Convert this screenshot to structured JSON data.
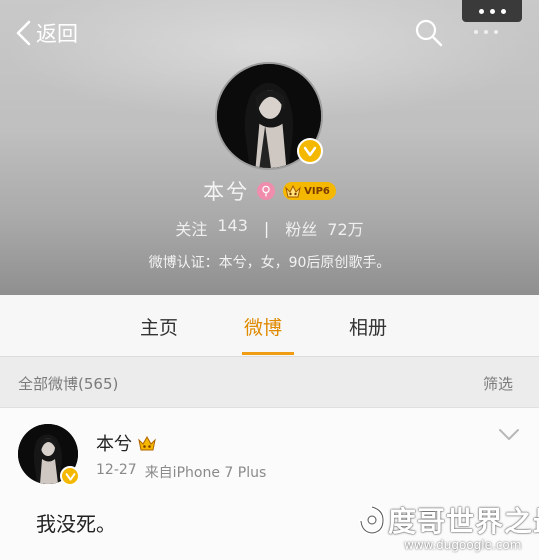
{
  "colors": {
    "accent": "#f19c15",
    "vip_gold": "#f5b800",
    "header_bg": "#bdbdbd",
    "tab_bar_bg": "#f7f7f7",
    "feed_bg": "#ececec",
    "gender_pink": "#f08dac"
  },
  "nav": {
    "back_label": "返回",
    "back_icon": "chevron-left-icon",
    "search_icon": "search-icon",
    "more_icon": "more-dots-icon"
  },
  "profile": {
    "name": "本兮",
    "vip_label": "VIP6",
    "following_label": "关注",
    "following_count": "143",
    "separator": "|",
    "followers_label": "粉丝",
    "followers_count": "72万",
    "verification": "微博认证：本兮，女，90后原创歌手。"
  },
  "tabs": [
    {
      "label": "主页",
      "active": false
    },
    {
      "label": "微博",
      "active": true
    },
    {
      "label": "相册",
      "active": false
    }
  ],
  "feed": {
    "all_label": "全部微博(565)",
    "filter_label": "筛选"
  },
  "post": {
    "author": "本兮",
    "date": "12-27",
    "source": "来自iPhone 7 Plus",
    "text": "我没死。"
  },
  "watermark": {
    "title": "度哥世界之最",
    "url": "www.dugoogle.com"
  }
}
